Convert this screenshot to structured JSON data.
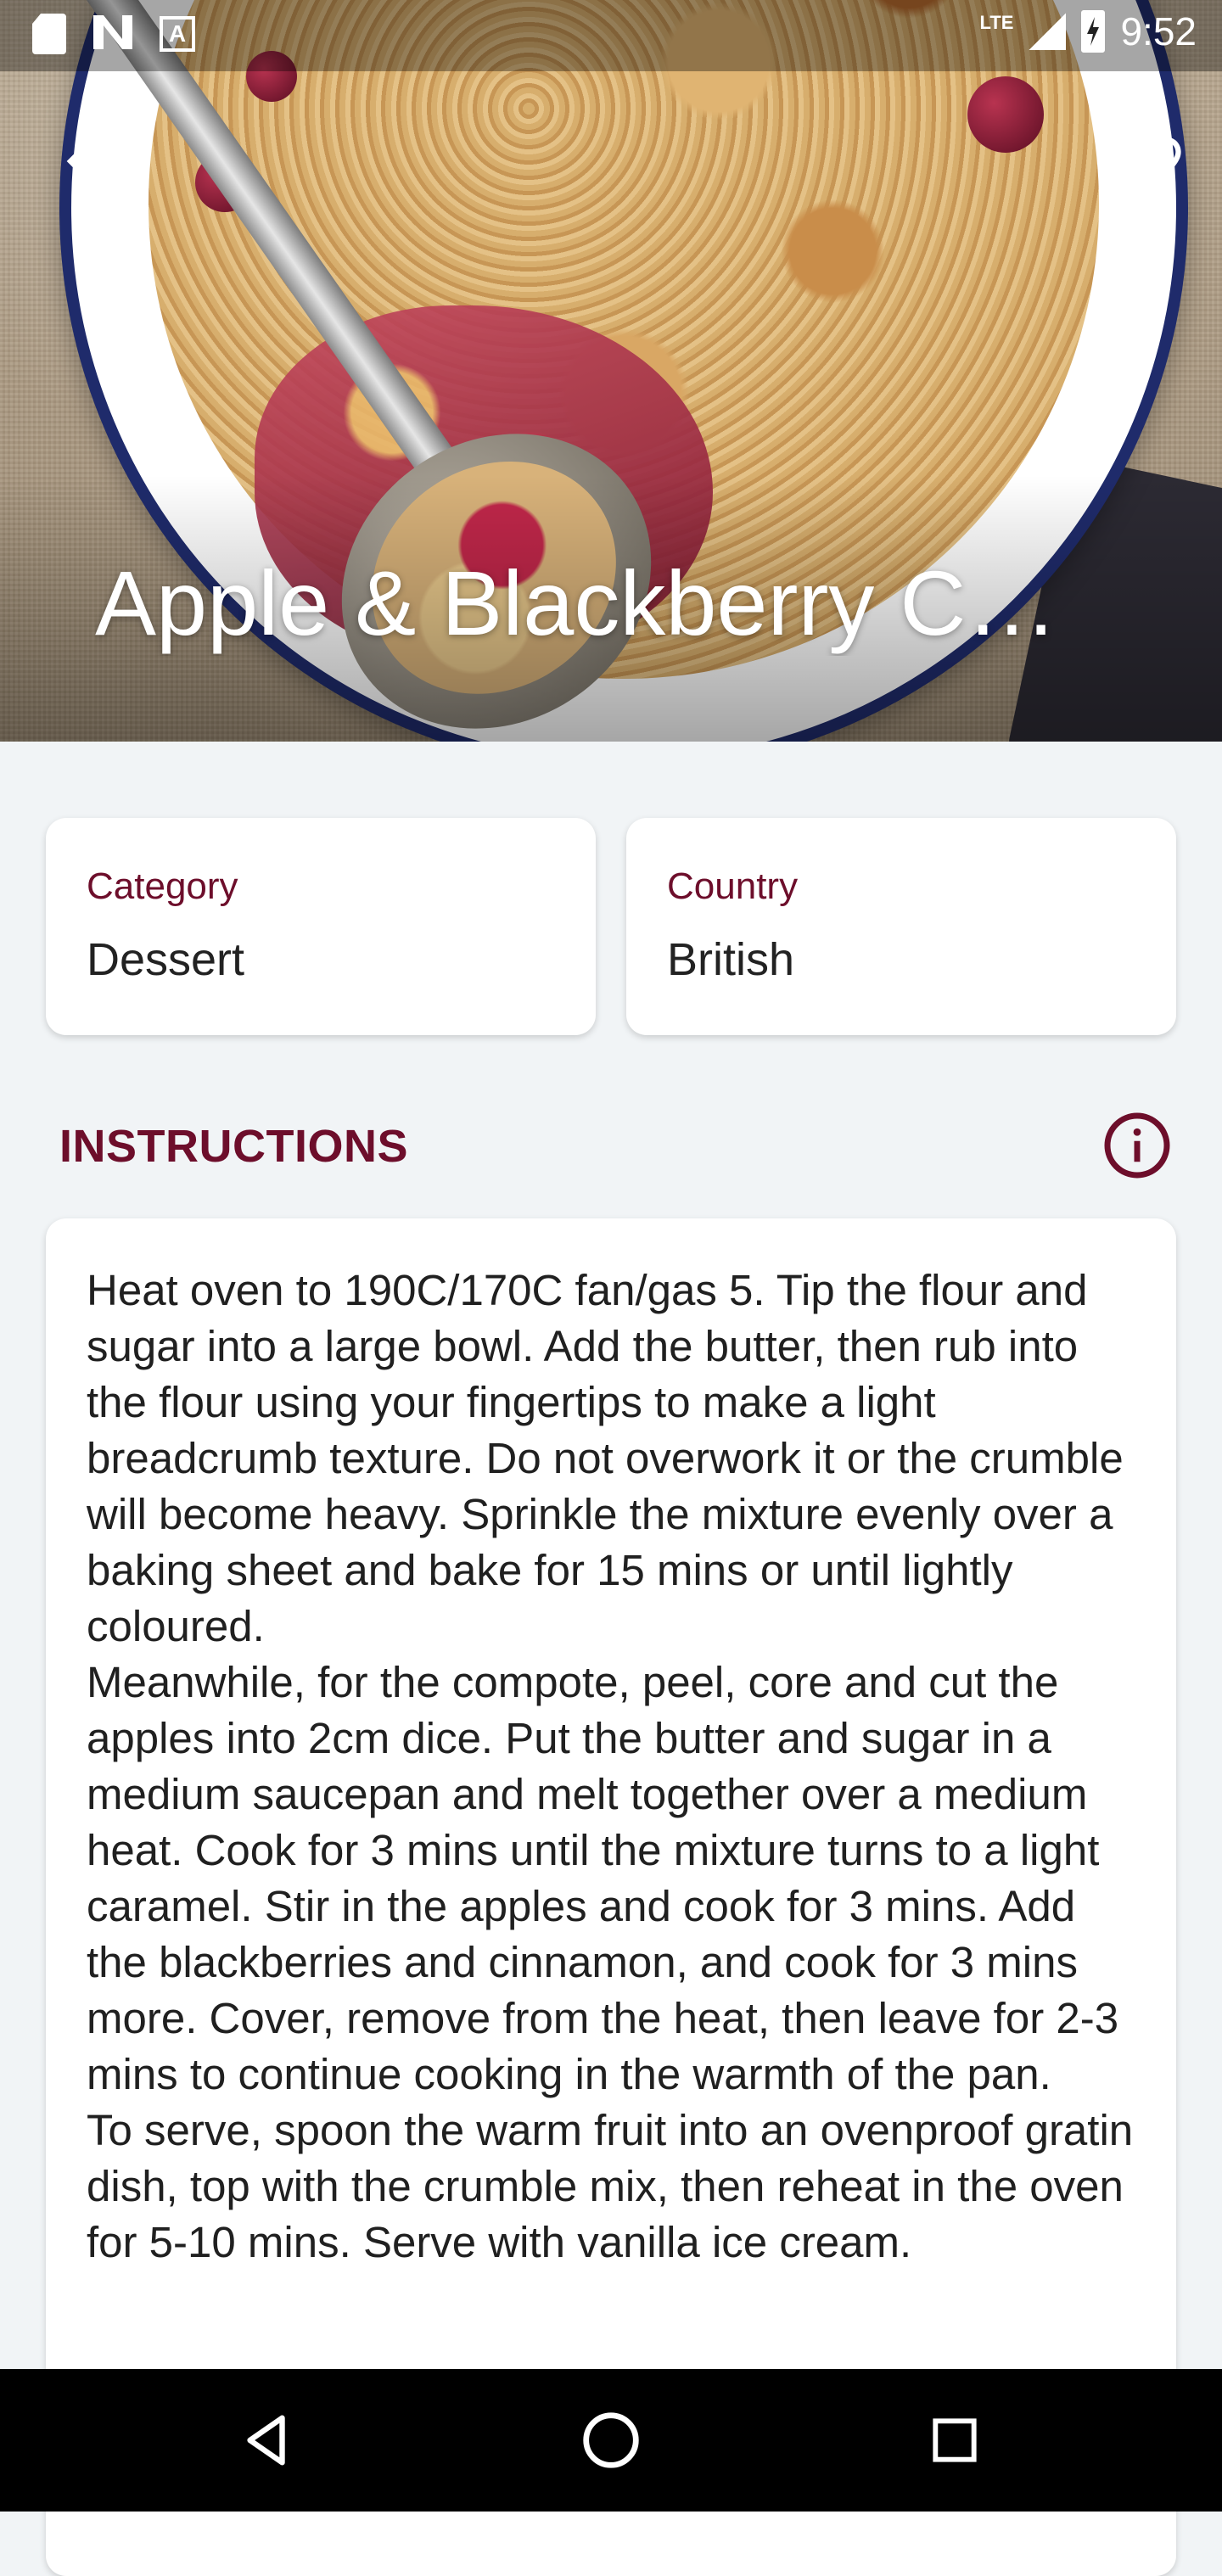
{
  "status_bar": {
    "time": "9:52",
    "network": "LTE",
    "icons": [
      "sd-card-icon",
      "n-logo-icon",
      "accessibility-icon",
      "signal-icon",
      "battery-charging-icon"
    ]
  },
  "header": {
    "title": "Apple & Blackberry C…",
    "back_icon": "arrow-back-icon",
    "favorite_icon": "heart-outline-icon"
  },
  "details": {
    "category_label": "Category",
    "category_value": "Dessert",
    "country_label": "Country",
    "country_value": "British"
  },
  "instructions": {
    "title": "INSTRUCTIONS",
    "info_icon": "info-icon",
    "text": "Heat oven to 190C/170C fan/gas 5. Tip the flour and sugar into a large bowl. Add the butter, then rub into the flour using your fingertips to make a light breadcrumb texture. Do not overwork it or the crumble will become heavy. Sprinkle the mixture evenly over a baking sheet and bake for 15 mins or until lightly coloured.\nMeanwhile, for the compote, peel, core and cut the apples into 2cm dice. Put the butter and sugar in a medium saucepan and melt together over a medium heat. Cook for 3 mins until the mixture turns to a light caramel. Stir in the apples and cook for 3 mins. Add the blackberries and cinnamon, and cook for 3 mins more. Cover, remove from the heat, then leave for 2-3 mins to continue cooking in the warmth of the pan.\nTo serve, spoon the warm fruit into an ovenproof gratin dish, top with the crumble mix, then reheat in the oven for 5-10 mins. Serve with vanilla ice cream."
  },
  "nav": {
    "icons": [
      "nav-back-icon",
      "nav-home-icon",
      "nav-recents-icon"
    ]
  },
  "colors": {
    "accent": "#6d0e2b",
    "background": "#f1f4f6",
    "card": "#ffffff",
    "navbar": "#000000"
  }
}
